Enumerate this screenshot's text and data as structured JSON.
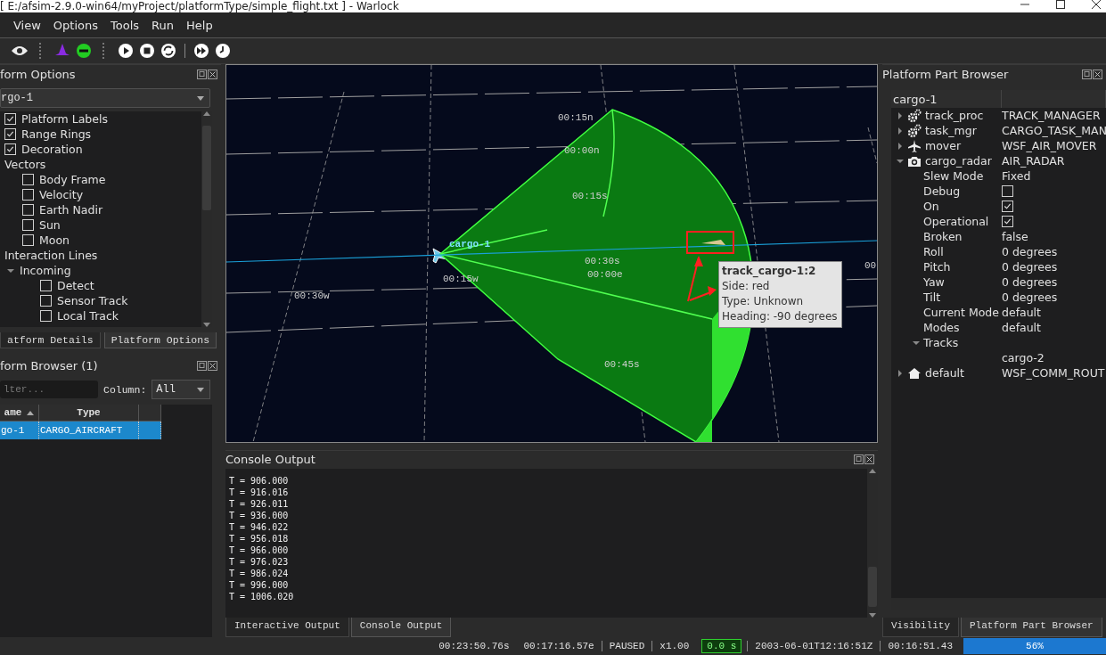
{
  "window": {
    "title": "[ E:/afsim-2.9.0-win64/myProject/platformType/simple_flight.txt ] - Warlock"
  },
  "menu": [
    "View",
    "Options",
    "Tools",
    "Run",
    "Help"
  ],
  "platform_options": {
    "title": "form Options",
    "platform": "rgo-1",
    "items": [
      {
        "label": "Platform Labels",
        "kind": "checkbox",
        "checked": true
      },
      {
        "label": "Range Rings",
        "kind": "checkbox",
        "checked": true
      },
      {
        "label": "Decoration",
        "kind": "checkbox",
        "checked": true
      },
      {
        "label": "Vectors",
        "kind": "group",
        "children": [
          {
            "label": "Body Frame",
            "kind": "checkbox",
            "checked": false
          },
          {
            "label": "Velocity",
            "kind": "checkbox",
            "checked": false
          },
          {
            "label": "Earth Nadir",
            "kind": "checkbox",
            "checked": false
          },
          {
            "label": "Sun",
            "kind": "checkbox",
            "checked": false
          },
          {
            "label": "Moon",
            "kind": "checkbox",
            "checked": false
          }
        ]
      },
      {
        "label": "Interaction Lines",
        "kind": "group",
        "children": [
          {
            "label": "Incoming",
            "kind": "group",
            "expanded": true,
            "children": [
              {
                "label": "Detect",
                "kind": "checkbox",
                "checked": false
              },
              {
                "label": "Sensor Track",
                "kind": "checkbox",
                "checked": false
              },
              {
                "label": "Local Track",
                "kind": "checkbox",
                "checked": false
              }
            ]
          }
        ]
      }
    ]
  },
  "left_tabs": [
    {
      "label": "atform Details",
      "selected": false
    },
    {
      "label": "Platform Options",
      "selected": true
    }
  ],
  "platform_browser": {
    "title": "form Browser (1)",
    "filter_placeholder": "lter...",
    "column_label": "Column:",
    "column_value": "All",
    "columns": [
      "ame",
      "Type"
    ],
    "rows": [
      {
        "cells": [
          "go-1",
          "CARGO_AIRCRAFT"
        ],
        "selected": true
      }
    ]
  },
  "viewport": {
    "time_labels": [
      "00:15n",
      "00:00n",
      "00:15s",
      "00:30s",
      "00",
      "00:15w",
      "00:00e",
      "00:30w",
      "00:45s"
    ],
    "platform_label": "cargo-1",
    "tooltip": {
      "title": "track_cargo-1:2",
      "lines": [
        "Side: red",
        "Type: Unknown",
        "Heading: -90 degrees"
      ]
    }
  },
  "console": {
    "title": "Console Output",
    "lines": [
      "T = 906.000",
      "T = 916.016",
      "T = 926.011",
      "T = 936.000",
      "T = 946.022",
      "T = 956.018",
      "T = 966.000",
      "T = 976.023",
      "T = 986.024",
      "T = 996.000",
      "T = 1006.020"
    ]
  },
  "bottom_tabs": [
    {
      "label": "Interactive Output",
      "selected": false
    },
    {
      "label": "Console Output",
      "selected": true
    }
  ],
  "part_browser": {
    "title": "Platform Part Browser",
    "root": "cargo-1",
    "items": [
      {
        "name": "track_proc",
        "kind": "gear",
        "value": "TRACK_MANAGER",
        "expanded": false
      },
      {
        "name": "task_mgr",
        "kind": "gear",
        "value": "CARGO_TASK_MAN",
        "expanded": false
      },
      {
        "name": "mover",
        "kind": "plane",
        "value": "WSF_AIR_MOVER",
        "expanded": false
      },
      {
        "name": "cargo_radar",
        "kind": "camera",
        "value": "AIR_RADAR",
        "expanded": true,
        "children": [
          {
            "name": "Slew Mode",
            "kind": "text",
            "value": "Fixed"
          },
          {
            "name": "Debug",
            "kind": "checkbox",
            "checked": false
          },
          {
            "name": "On",
            "kind": "checkbox",
            "checked": true
          },
          {
            "name": "Operational",
            "kind": "checkbox",
            "checked": true
          },
          {
            "name": "Broken",
            "kind": "text",
            "value": "false"
          },
          {
            "name": "Roll",
            "kind": "text",
            "value": "0 degrees"
          },
          {
            "name": "Pitch",
            "kind": "text",
            "value": "0 degrees"
          },
          {
            "name": "Yaw",
            "kind": "text",
            "value": "0 degrees"
          },
          {
            "name": "Tilt",
            "kind": "text",
            "value": "0 degrees"
          },
          {
            "name": "Current Mode",
            "kind": "text",
            "value": "default"
          },
          {
            "name": "Modes",
            "kind": "text",
            "value": "default"
          },
          {
            "name": "Tracks",
            "kind": "text",
            "expanded": true,
            "children": [
              {
                "kind": "text",
                "value": "cargo-2"
              }
            ]
          }
        ]
      },
      {
        "name": "default",
        "kind": "house",
        "value": "WSF_COMM_ROUT",
        "expanded": false
      }
    ]
  },
  "right_tabs": [
    {
      "label": "Visibility",
      "selected": false
    },
    {
      "label": "Platform Part Browser",
      "selected": true
    }
  ],
  "status_bar": {
    "fields": [
      {
        "text": "00:23:50.76s",
        "kind": "plain"
      },
      {
        "text": "00:17:16.57e",
        "kind": "plain"
      },
      {
        "text": "PAUSED",
        "kind": "boxed"
      },
      {
        "text": "x1.00",
        "kind": "boxed"
      },
      {
        "text": "0.0 s",
        "kind": "highlight"
      },
      {
        "text": "2003-06-01T12:16:51Z",
        "kind": "boxed"
      },
      {
        "text": "00:16:51.43",
        "kind": "boxed"
      }
    ],
    "progress": "56%"
  }
}
